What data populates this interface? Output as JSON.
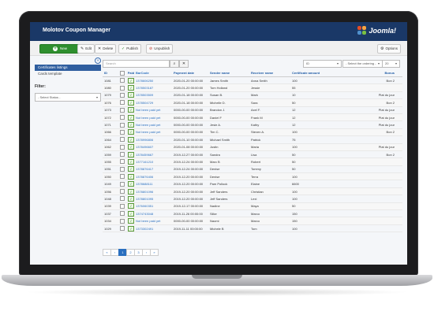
{
  "app": {
    "title": "Molotov Coupon Manager",
    "brand": "Joomla!"
  },
  "toolbar": {
    "new": "New",
    "edit": "Edit",
    "delete": "Delete",
    "publish": "Publish",
    "unpublish": "Unpublish",
    "options": "Options"
  },
  "sidebar": {
    "items": [
      {
        "label": "Certificates listings"
      },
      {
        "label": "Cards template"
      }
    ],
    "filter_label": "Filter:",
    "status_select": "- Select Status -"
  },
  "search": {
    "placeholder": "Search",
    "ordering": "ID",
    "direction": "- Select the ordering -",
    "limit": "20"
  },
  "table": {
    "headers": {
      "id": "ID",
      "paid": "Paid",
      "barcode": "BarCode",
      "date": "Payment date",
      "sender": "Sender name",
      "receiver": "Receiver name",
      "amount": "Certificate amount",
      "bonus": "Bonus"
    },
    "rows": [
      {
        "id": "1081",
        "paid": true,
        "barcode": "1378606250",
        "date": "2020-01-20 00:00:00",
        "sender": "James Smith",
        "receiver": "Anna Smith",
        "amount": "100",
        "bonus": "Bon 2"
      },
      {
        "id": "1080",
        "paid": true,
        "barcode": "1378503187",
        "date": "2020-01-20 00:00:00",
        "sender": "Tom Holland",
        "receiver": "Jessie",
        "amount": "55",
        "bonus": ""
      },
      {
        "id": "1079",
        "paid": true,
        "barcode": "1378503509",
        "date": "2020-01-18 00:00:00",
        "sender": "Susan B.",
        "receiver": "Mark",
        "amount": "10",
        "bonus": "Plat du jour"
      },
      {
        "id": "1076",
        "paid": true,
        "barcode": "1378504729",
        "date": "2020-01-18 00:00:00",
        "sender": "Michelle D.",
        "receiver": "Sara",
        "amount": "50",
        "bonus": "Bon 2"
      },
      {
        "id": "1073",
        "paid": true,
        "barcode": "Not been paid yet",
        "date": "0000-00-00 00:00:00",
        "sender": "Brandon J.",
        "receiver": "Axel F.",
        "amount": "12",
        "bonus": "Plat du jour"
      },
      {
        "id": "1072",
        "paid": true,
        "barcode": "Not been paid yet",
        "date": "0000-00-00 00:00:00",
        "sender": "Daniel F",
        "receiver": "Frank M",
        "amount": "12",
        "bonus": "Plat du jour"
      },
      {
        "id": "1071",
        "paid": true,
        "barcode": "Not been paid yet",
        "date": "0000-00-00 00:00:00",
        "sender": "Jesie A.",
        "receiver": "Kathy",
        "amount": "12",
        "bonus": "Plat du jour"
      },
      {
        "id": "1066",
        "paid": true,
        "barcode": "Not been paid yet",
        "date": "0000-00-00 00:00:00",
        "sender": "Tim C.",
        "receiver": "Steven A.",
        "amount": "100",
        "bonus": "Bon 2"
      },
      {
        "id": "1064",
        "paid": true,
        "barcode": "1378996806",
        "date": "2020-01-10 00:00:00",
        "sender": "Michael Smith",
        "receiver": "Patrick",
        "amount": "75",
        "bonus": ""
      },
      {
        "id": "1062",
        "paid": true,
        "barcode": "1378496607",
        "date": "2020-01-08 00:00:00",
        "sender": "Justin",
        "receiver": "Maria",
        "amount": "100",
        "bonus": "Plat du jour"
      },
      {
        "id": "1059",
        "paid": true,
        "barcode": "1378459667",
        "date": "2019-12-27 00:00:00",
        "sender": "Sandra",
        "receiver": "Lisa",
        "amount": "50",
        "bonus": "Bon 2"
      },
      {
        "id": "1055",
        "paid": true,
        "barcode": "1377161210",
        "date": "2019-12-24 00:00:00",
        "sender": "Marc B",
        "receiver": "Robert",
        "amount": "50",
        "bonus": ""
      },
      {
        "id": "1051",
        "paid": true,
        "barcode": "1378876417",
        "date": "2019-12-24 00:00:00",
        "sender": "Denise",
        "receiver": "Tommy",
        "amount": "50",
        "bonus": ""
      },
      {
        "id": "1050",
        "paid": true,
        "barcode": "1378876406",
        "date": "2019-12-20 00:00:00",
        "sender": "Denise",
        "receiver": "Terra",
        "amount": "100",
        "bonus": ""
      },
      {
        "id": "1049",
        "paid": true,
        "barcode": "1378688111",
        "date": "2019-12-20 00:00:00",
        "sender": "Pam Pollock",
        "receiver": "Elaine",
        "amount": "6600",
        "bonus": ""
      },
      {
        "id": "1056",
        "paid": true,
        "barcode": "1378801096",
        "date": "2019-12-20 00:00:00",
        "sender": "Jeff Sanders",
        "receiver": "Christian",
        "amount": "100",
        "bonus": ""
      },
      {
        "id": "1048",
        "paid": true,
        "barcode": "1378801095",
        "date": "2019-12-20 00:00:00",
        "sender": "Jeff Sanders",
        "receiver": "Lexi",
        "amount": "100",
        "bonus": ""
      },
      {
        "id": "1039",
        "paid": true,
        "barcode": "1376060351",
        "date": "2019-12-17 00:00:00",
        "sender": "Nadine",
        "receiver": "Maya",
        "amount": "50",
        "bonus": ""
      },
      {
        "id": "1037",
        "paid": true,
        "barcode": "1374743048",
        "date": "2019-11-26 00:00:00",
        "sender": "Silke",
        "receiver": "Marco",
        "amount": "150",
        "bonus": ""
      },
      {
        "id": "1034",
        "paid": true,
        "barcode": "Not been paid yet",
        "date": "0000-00-00 00:00:00",
        "sender": "Naomi",
        "receiver": "Marco",
        "amount": "150",
        "bonus": ""
      },
      {
        "id": "1029",
        "paid": true,
        "barcode": "1373302491",
        "date": "2019-11-11 00:00:00",
        "sender": "Michele B",
        "receiver": "Tom",
        "amount": "100",
        "bonus": ""
      }
    ]
  },
  "pagination": {
    "first": "«",
    "prev": "‹",
    "p1": "1",
    "p2": "2",
    "p3": "3",
    "next": "›",
    "last": "»"
  },
  "colors": {
    "header": "#1a3867",
    "accent": "#2a6fbf",
    "new_button": "#2f8f2f"
  }
}
